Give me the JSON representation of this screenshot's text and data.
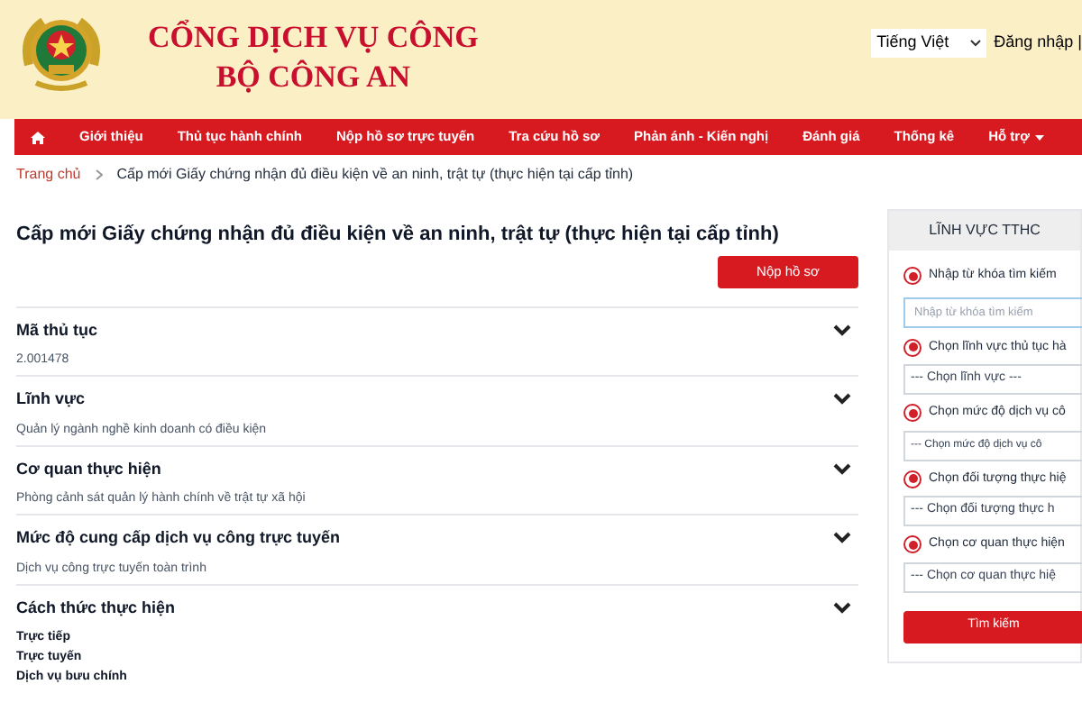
{
  "header": {
    "title_line_1": "CỔNG DỊCH VỤ CÔNG",
    "title_line_2": "BỘ CÔNG AN",
    "language": "Tiếng Việt",
    "login": "Đăng nhập |"
  },
  "nav": {
    "items": [
      {
        "label": "Giới thiệu",
        "dropdown": false
      },
      {
        "label": "Thủ tục hành chính",
        "dropdown": false
      },
      {
        "label": "Nộp hồ sơ trực tuyến",
        "dropdown": false
      },
      {
        "label": "Tra cứu hồ sơ",
        "dropdown": false
      },
      {
        "label": "Phản ánh - Kiến nghị",
        "dropdown": false
      },
      {
        "label": "Đánh giá",
        "dropdown": false
      },
      {
        "label": "Thống kê",
        "dropdown": false
      },
      {
        "label": "Hỗ trợ",
        "dropdown": true
      }
    ]
  },
  "breadcrumb": [
    "Trang chủ",
    "Cấp mới Giấy chứng nhận đủ điều kiện về an ninh, trật tự (thực hiện tại cấp tỉnh)"
  ],
  "page_title": "Cấp mới Giấy chứng nhận đủ điều kiện về an ninh, trật tự (thực hiện tại cấp tỉnh)",
  "submit_button": "Nộp hồ sơ",
  "sections": [
    {
      "heading": "Mã thủ tục",
      "kind": "text",
      "values": [
        "2.001478"
      ]
    },
    {
      "heading": "Lĩnh vực",
      "kind": "text",
      "values": [
        "Quản lý ngành nghề kinh doanh có điều kiện"
      ]
    },
    {
      "heading": "Cơ quan thực hiện",
      "kind": "text",
      "values": [
        "Phòng cảnh sát quản lý hành chính về trật tự xã hội"
      ]
    },
    {
      "heading": "Mức độ cung cấp dịch vụ công trực tuyến",
      "kind": "text",
      "values": [
        "Dịch vụ công trực tuyến toàn trình"
      ]
    },
    {
      "heading": "Cách thức thực hiện",
      "kind": "list",
      "values": [
        "Trực tiếp",
        "Trực tuyến",
        "Dịch vụ bưu chính"
      ]
    }
  ],
  "sidebar": {
    "title": "LĨNH VỰC TTHC",
    "filters": [
      {
        "label": "Nhập từ khóa tìm kiếm",
        "selected": true,
        "kind": "input",
        "placeholder": "Nhập từ khóa tìm kiếm"
      },
      {
        "label": "Chọn lĩnh vực thủ tục hà",
        "selected": true,
        "kind": "select",
        "value": "--- Chọn lĩnh vực ---"
      },
      {
        "label": "Chọn mức độ dịch vụ cô",
        "selected": true,
        "kind": "select_small",
        "value": "--- Chọn mức độ dịch vụ cô"
      },
      {
        "label": "Chọn đối tượng thực hiệ",
        "selected": true,
        "kind": "select",
        "value": "--- Chọn đối tượng thực h"
      },
      {
        "label": "Chọn cơ quan thực hiện",
        "selected": true,
        "kind": "select",
        "value": "--- Chọn cơ quan thực hiệ"
      }
    ],
    "button": "Tìm kiếm"
  }
}
